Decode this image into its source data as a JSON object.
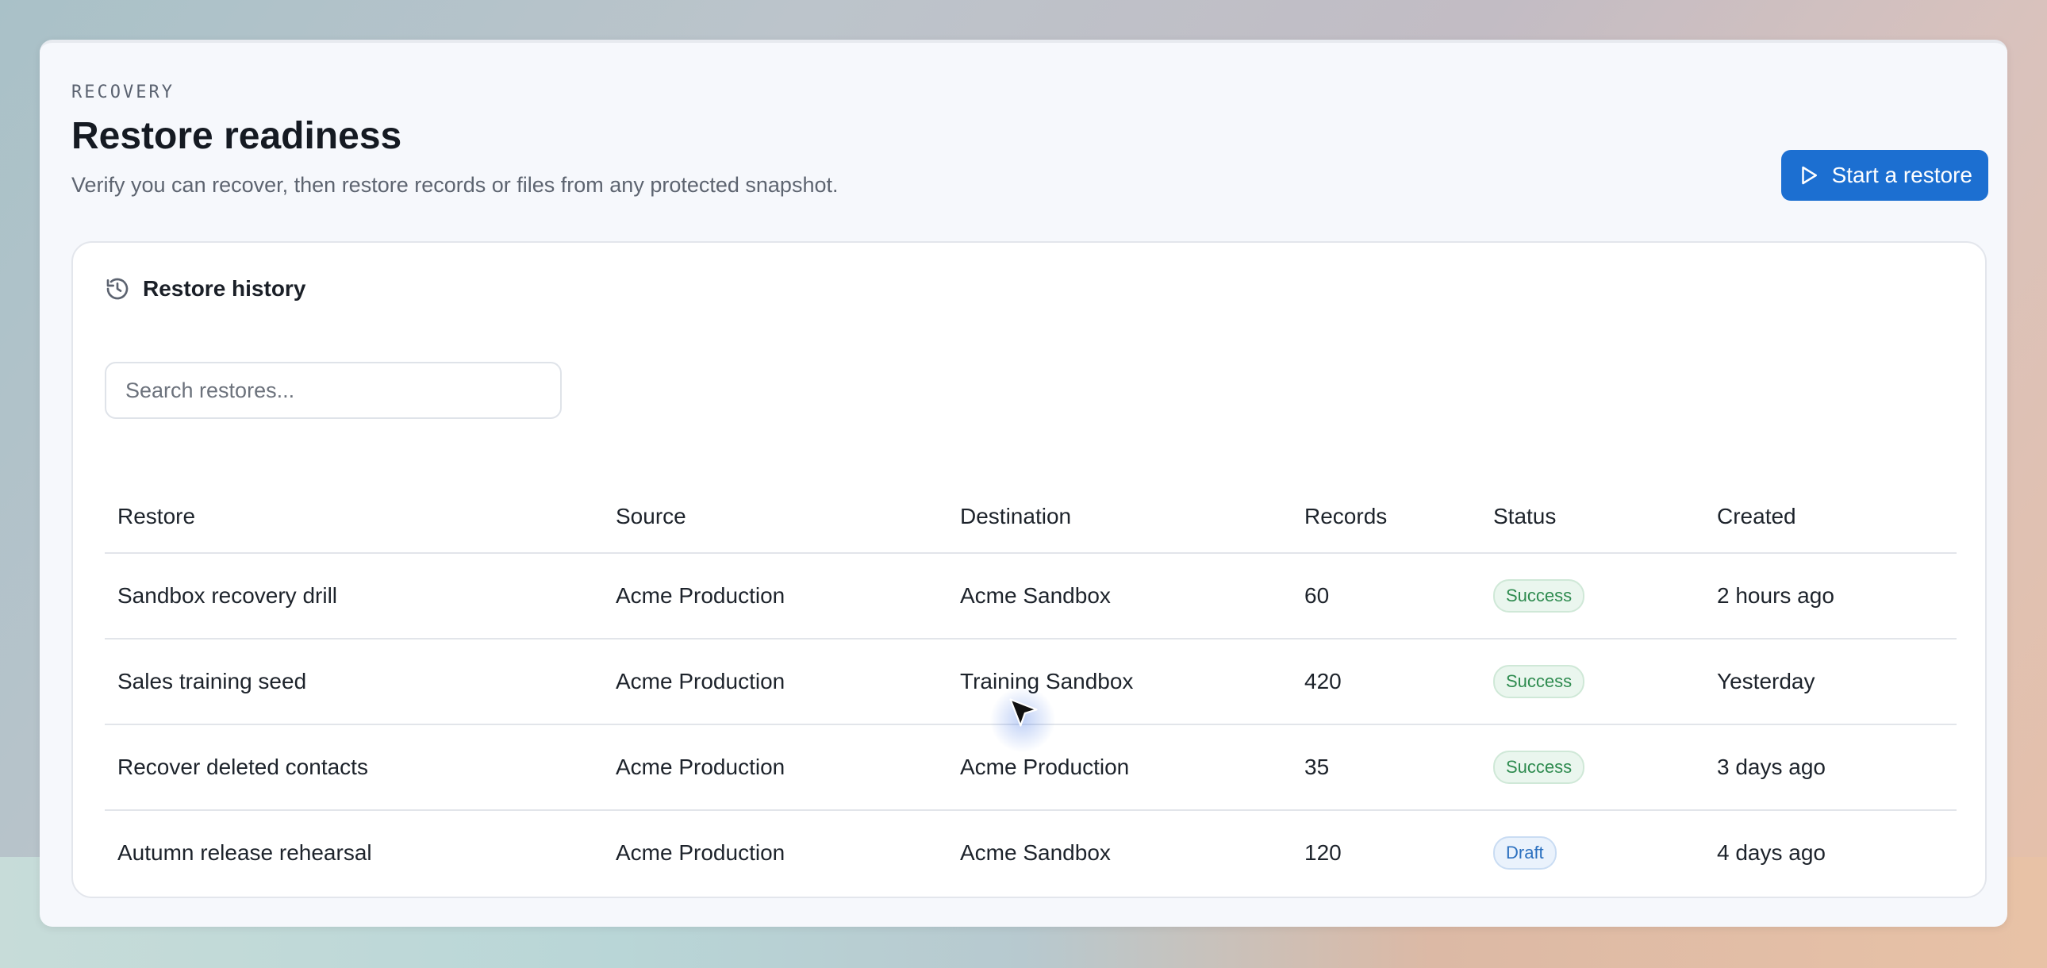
{
  "header": {
    "eyebrow": "RECOVERY",
    "title": "Restore readiness",
    "subtitle": "Verify you can recover, then restore records or files from any protected snapshot.",
    "primary_action": "Start a restore"
  },
  "history": {
    "title": "Restore history",
    "icon": "history-icon",
    "search_placeholder": "Search restores...",
    "columns": [
      "Restore",
      "Source",
      "Destination",
      "Records",
      "Status",
      "Created"
    ],
    "rows": [
      {
        "name": "Sandbox recovery drill",
        "source": "Acme Production",
        "destination": "Acme Sandbox",
        "records": "60",
        "status": "Success",
        "created": "2 hours ago"
      },
      {
        "name": "Sales training seed",
        "source": "Acme Production",
        "destination": "Training Sandbox",
        "records": "420",
        "status": "Success",
        "created": "Yesterday"
      },
      {
        "name": "Recover deleted contacts",
        "source": "Acme Production",
        "destination": "Acme Production",
        "records": "35",
        "status": "Success",
        "created": "3 days ago"
      },
      {
        "name": "Autumn release rehearsal",
        "source": "Acme Production",
        "destination": "Acme Sandbox",
        "records": "120",
        "status": "Draft",
        "created": "4 days ago"
      }
    ]
  },
  "colors": {
    "primary": "#1c6fd1",
    "success": "#2e8b4f",
    "draft": "#2a6fbf"
  }
}
